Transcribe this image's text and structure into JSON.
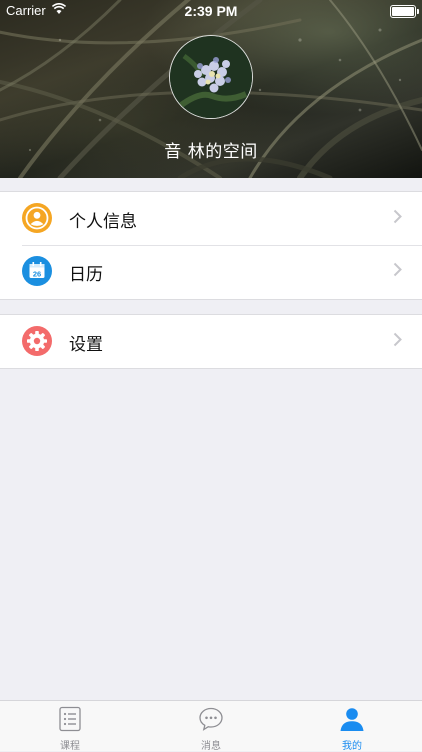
{
  "status_bar": {
    "carrier": "Carrier",
    "time": "2:39 PM"
  },
  "profile": {
    "username": "音 林的空间"
  },
  "menu_groups": [
    {
      "items": [
        {
          "label": "个人信息",
          "icon": "user-icon",
          "color": "#f5a623"
        },
        {
          "label": "日历",
          "icon": "calendar-icon",
          "color": "#1b8fe0",
          "badge": "26"
        }
      ]
    },
    {
      "items": [
        {
          "label": "设置",
          "icon": "gear-icon",
          "color": "#f36b6b"
        }
      ]
    }
  ],
  "tabbar": {
    "tabs": [
      {
        "label": "课程",
        "icon": "list-icon",
        "active": false
      },
      {
        "label": "消息",
        "icon": "chat-bubble-icon",
        "active": false
      },
      {
        "label": "我的",
        "icon": "person-icon",
        "active": true
      }
    ]
  },
  "colors": {
    "accent": "#1a8cf0",
    "background": "#efeff4",
    "inactive_tab": "#8e8e93"
  }
}
